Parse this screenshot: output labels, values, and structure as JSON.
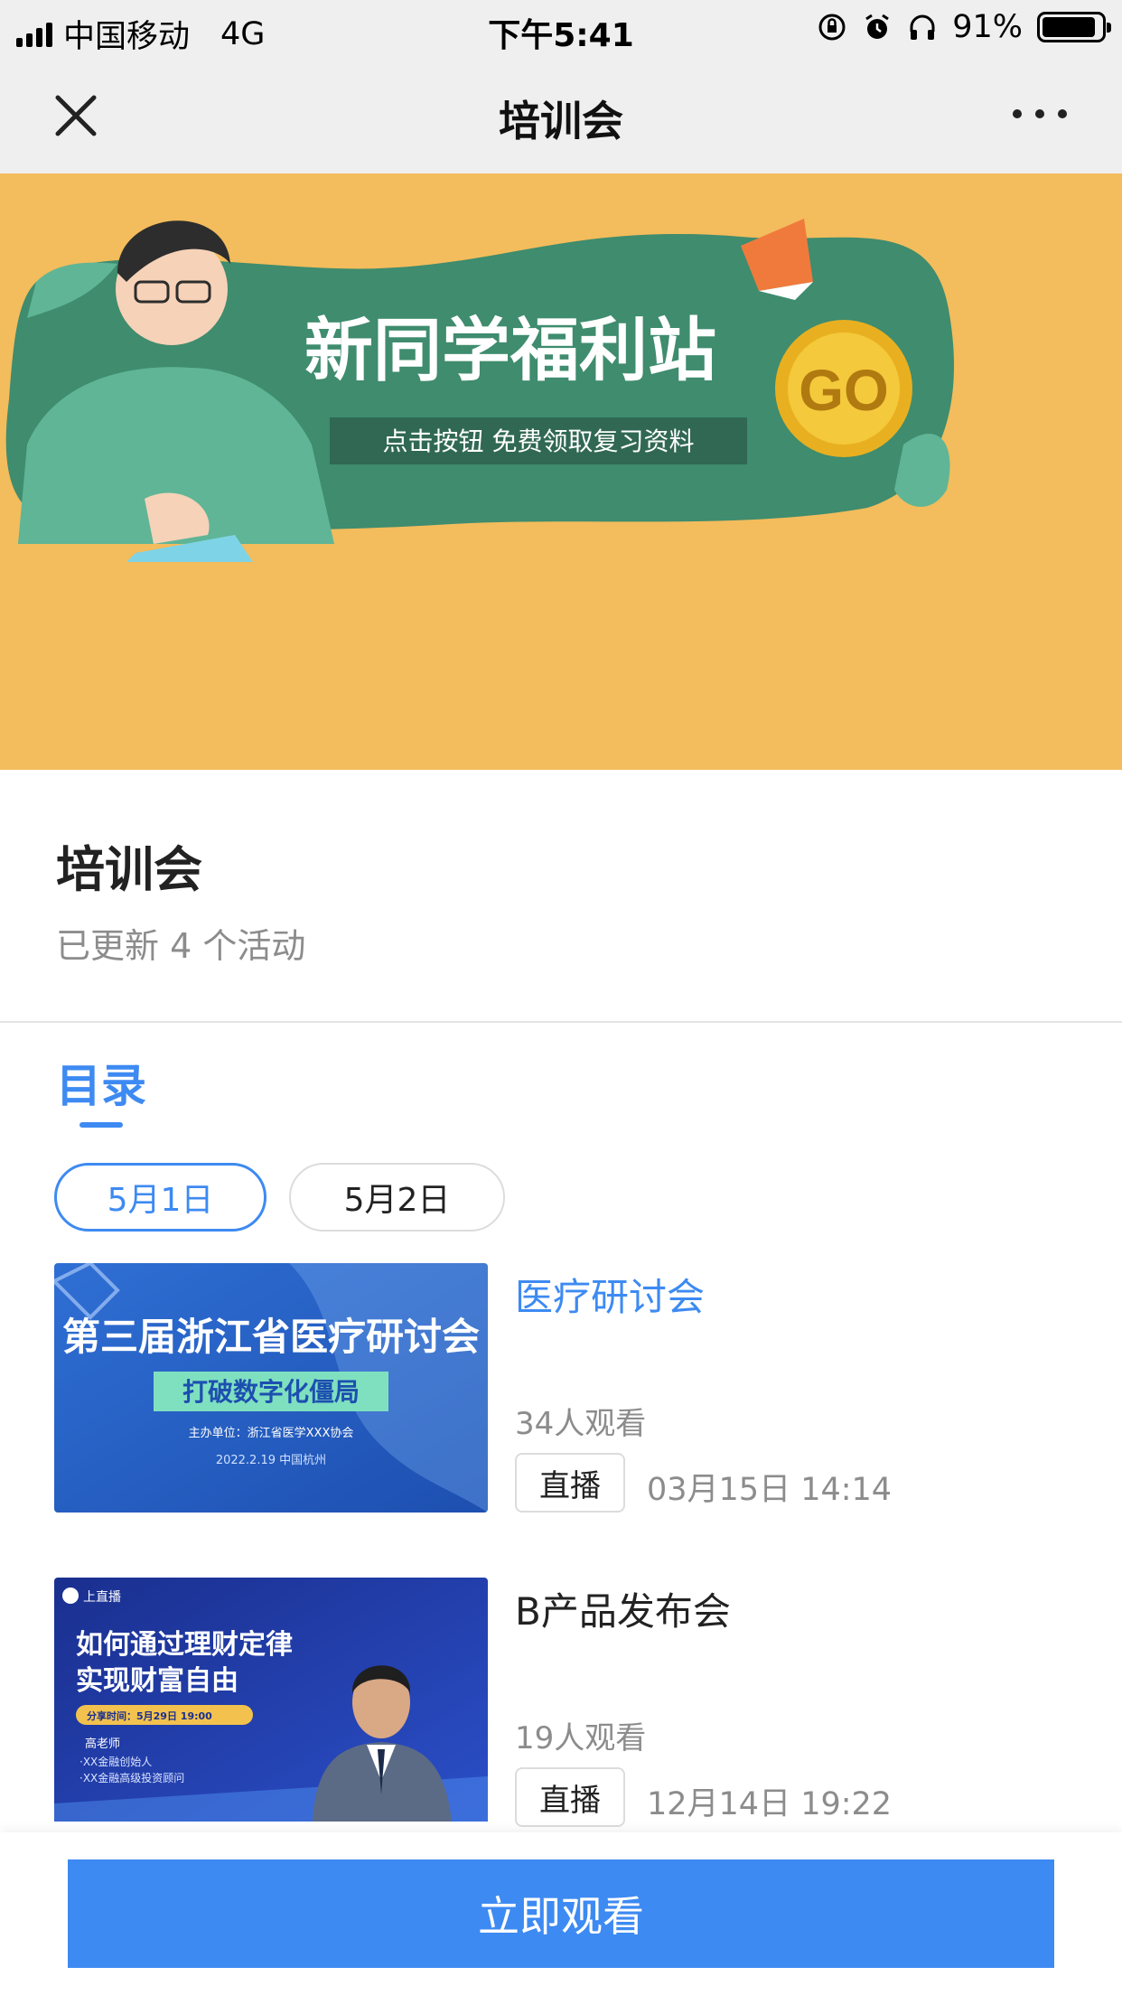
{
  "status_bar": {
    "carrier": "中国移动",
    "network": "4G",
    "time": "下午5:41",
    "battery": "91%",
    "battery_level": 0.91
  },
  "nav": {
    "title": "培训会"
  },
  "banner": {
    "headline": "新同学福利站",
    "subline": "点击按钮  免费领取复习资料",
    "go_label": "GO",
    "background_color": "#f3bc5c"
  },
  "header": {
    "title": "培训会",
    "subtitle": "已更新 4 个活动"
  },
  "catalog": {
    "tab_label": "目录",
    "date_chips": [
      {
        "label": "5月1日",
        "selected": true
      },
      {
        "label": "5月2日",
        "selected": false
      }
    ]
  },
  "items": [
    {
      "title": "医疗研讨会",
      "views": "34人观看",
      "badge": "直播",
      "time": "03月15日 14:14",
      "title_color": "#3d8af2",
      "thumb": {
        "headline": "第三届浙江省医疗研讨会",
        "subtitle": "打破数字化僵局",
        "organizer": "主办单位：浙江省医学XXX协会",
        "date_place": "2022.2.19  中国杭州"
      }
    },
    {
      "title": "B产品发布会",
      "views": "19人观看",
      "badge": "直播",
      "time": "12月14日 19:22",
      "title_color": "#222222",
      "thumb": {
        "brand": "上直播",
        "headline_1": "如何通过理财定律",
        "headline_2": "实现财富自由",
        "share_time": "分享时间：5月29日 19:00",
        "teacher": "高老师",
        "role_1": "·XX金融创始人",
        "role_2": "·XX金融高级投资顾问"
      }
    }
  ],
  "bottom": {
    "watch_label": "立即观看",
    "accent_color": "#3d8af2"
  }
}
